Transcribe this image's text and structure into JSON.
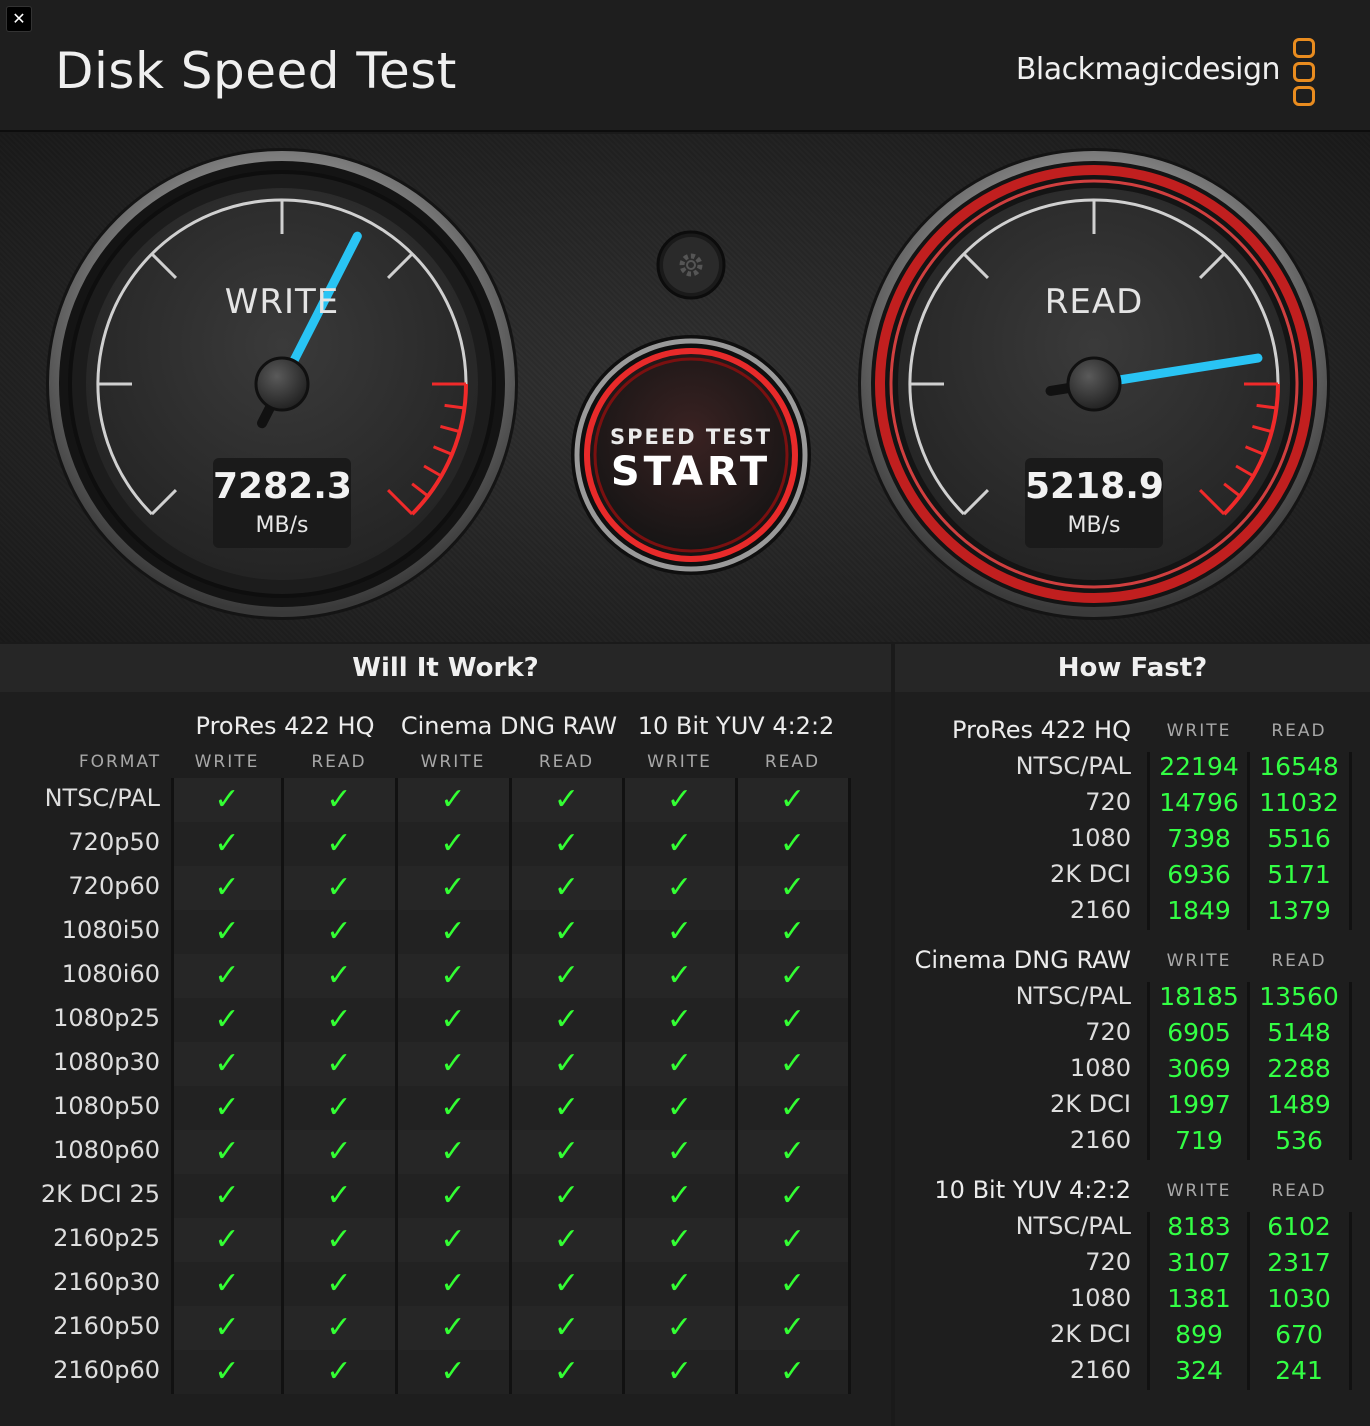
{
  "window": {
    "close_label": "✕"
  },
  "header": {
    "title": "Disk Speed Test",
    "brand": "Blackmagicdesign",
    "brand_color": "#e98c1f"
  },
  "gauges": {
    "write": {
      "label": "WRITE",
      "value": "7282.3",
      "unit": "MB/s",
      "needle_fraction": 0.6
    },
    "read": {
      "label": "READ",
      "value": "5218.9",
      "unit": "MB/s",
      "needle_fraction": 0.8,
      "highlighted": true
    }
  },
  "start_button": {
    "small": "SPEED TEST",
    "big": "START"
  },
  "settings_button": {
    "icon": "gear-icon"
  },
  "will_it_work": {
    "title": "Will It Work?",
    "format_header": "FORMAT",
    "groups": [
      "ProRes 422 HQ",
      "Cinema DNG RAW",
      "10 Bit YUV 4:2:2"
    ],
    "subcolumns": [
      "WRITE",
      "READ",
      "WRITE",
      "READ",
      "WRITE",
      "READ"
    ],
    "formats": [
      "NTSC/PAL",
      "720p50",
      "720p60",
      "1080i50",
      "1080i60",
      "1080p25",
      "1080p30",
      "1080p50",
      "1080p60",
      "2K DCI 25",
      "2160p25",
      "2160p30",
      "2160p50",
      "2160p60"
    ],
    "check_symbol": "✓",
    "check_color": "#33ff33"
  },
  "how_fast": {
    "title": "How Fast?",
    "write_header": "WRITE",
    "read_header": "READ",
    "groups": [
      {
        "name": "ProRes 422 HQ",
        "rows": [
          {
            "label": "NTSC/PAL",
            "write": "22194",
            "read": "16548"
          },
          {
            "label": "720",
            "write": "14796",
            "read": "11032"
          },
          {
            "label": "1080",
            "write": "7398",
            "read": "5516"
          },
          {
            "label": "2K DCI",
            "write": "6936",
            "read": "5171"
          },
          {
            "label": "2160",
            "write": "1849",
            "read": "1379"
          }
        ]
      },
      {
        "name": "Cinema DNG RAW",
        "rows": [
          {
            "label": "NTSC/PAL",
            "write": "18185",
            "read": "13560"
          },
          {
            "label": "720",
            "write": "6905",
            "read": "5148"
          },
          {
            "label": "1080",
            "write": "3069",
            "read": "2288"
          },
          {
            "label": "2K DCI",
            "write": "1997",
            "read": "1489"
          },
          {
            "label": "2160",
            "write": "719",
            "read": "536"
          }
        ]
      },
      {
        "name": "10 Bit YUV 4:2:2",
        "rows": [
          {
            "label": "NTSC/PAL",
            "write": "8183",
            "read": "6102"
          },
          {
            "label": "720",
            "write": "3107",
            "read": "2317"
          },
          {
            "label": "1080",
            "write": "1381",
            "read": "1030"
          },
          {
            "label": "2K DCI",
            "write": "899",
            "read": "670"
          },
          {
            "label": "2160",
            "write": "324",
            "read": "241"
          }
        ]
      }
    ]
  }
}
